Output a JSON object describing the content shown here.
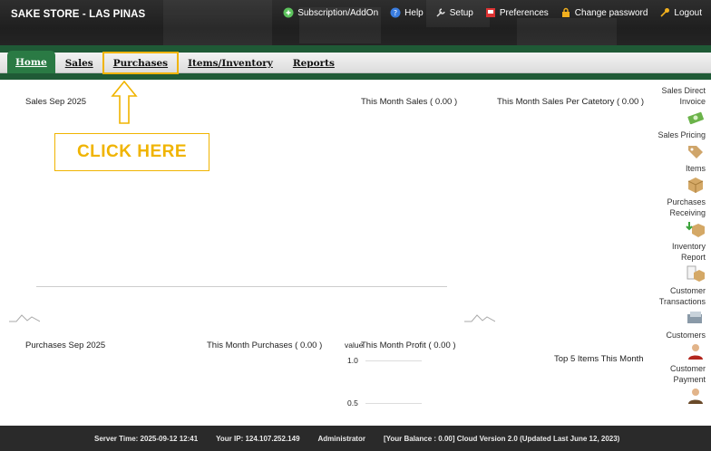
{
  "header": {
    "store_title": "SAKE STORE - LAS PINAS",
    "nav": {
      "subscription": "Subscription/AddOn",
      "help": "Help",
      "setup": "Setup",
      "preferences": "Preferences",
      "change_password": "Change password",
      "logout": "Logout"
    }
  },
  "menu": {
    "home": "Home",
    "sales": "Sales",
    "purchases": "Purchases",
    "items_inventory": "Items/Inventory",
    "reports": "Reports"
  },
  "callout": {
    "text": "CLICK HERE"
  },
  "dashboard": {
    "sales_title": "Sales Sep 2025",
    "month_sales": "This Month Sales ( 0.00 )",
    "month_sales_category": "This Month Sales Per Catetory ( 0.00 )",
    "purchases_title": "Purchases Sep 2025",
    "month_purchases": "This Month Purchases ( 0.00 )",
    "value_label": "value",
    "month_profit": "This Month Profit ( 0.00 )",
    "profit_ticks": [
      "1.0",
      "0.5"
    ],
    "top5": "Top 5 Items This Month"
  },
  "sidebar": [
    {
      "label": "Sales Direct Invoice",
      "icon": "cash-icon"
    },
    {
      "label": "Sales Pricing",
      "icon": "pricing-icon"
    },
    {
      "label": "Items",
      "icon": "items-box-icon"
    },
    {
      "label": "Purchases Receiving",
      "icon": "receiving-icon"
    },
    {
      "label": "Inventory Report",
      "icon": "inventory-report-icon"
    },
    {
      "label": "Customer Transactions",
      "icon": "customer-transactions-icon"
    },
    {
      "label": "Customers",
      "icon": "customers-icon"
    },
    {
      "label": "Customer Payment",
      "icon": "customer-payment-icon"
    }
  ],
  "footer": {
    "server_time": "Server Time: 2025-09-12 12:41",
    "ip": "Your IP: 124.107.252.149",
    "user": "Administrator",
    "version": "[Your Balance : 0.00] Cloud Version 2.0 (Updated Last June 12, 2023)"
  },
  "colors": {
    "accent_green": "#2a7a44",
    "callout_yellow": "#f0b400",
    "header_dark": "#262626"
  }
}
